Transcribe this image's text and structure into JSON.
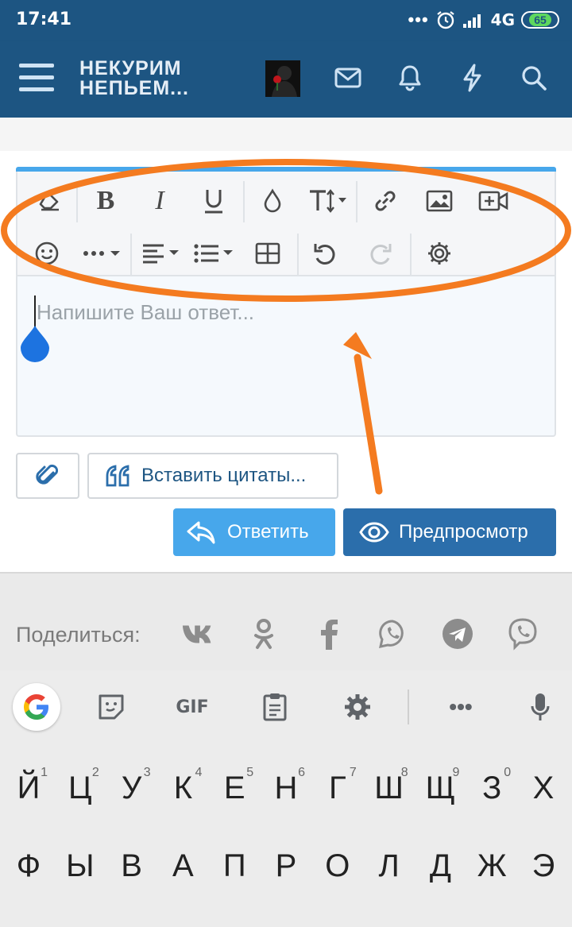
{
  "status": {
    "time": "17:41",
    "dots": "•••",
    "network": "4G",
    "battery": "65"
  },
  "header": {
    "logo_line1": "НЕКУРИМ",
    "logo_line2": "НЕПЬЕМ..."
  },
  "editor": {
    "placeholder": "Напишите Ваш ответ...",
    "toolbar_row1": [
      "eraser-icon",
      "bold-icon",
      "italic-icon",
      "underline-icon",
      "color-drop-icon",
      "font-size-icon",
      "link-icon",
      "image-icon",
      "video-icon"
    ],
    "toolbar_row2": [
      "smiley-icon",
      "more-icon",
      "align-icon",
      "list-icon",
      "table-icon",
      "undo-icon",
      "redo-icon",
      "settings-icon"
    ]
  },
  "buttons": {
    "quote_label": "Вставить цитаты...",
    "reply_label": "Ответить",
    "preview_label": "Предпросмотр"
  },
  "share": {
    "label": "Поделиться:",
    "icons": [
      "vk-icon",
      "ok-icon",
      "facebook-icon",
      "whatsapp-icon",
      "telegram-icon",
      "viber-icon"
    ]
  },
  "keyboard": {
    "toolbar_icons": [
      "google-icon",
      "sticker-icon",
      "gif-icon",
      "clipboard-icon",
      "settings-icon",
      "more-icon",
      "mic-icon"
    ],
    "gif_label": "GIF",
    "row1": [
      {
        "k": "Й",
        "n": "1"
      },
      {
        "k": "Ц",
        "n": "2"
      },
      {
        "k": "У",
        "n": "3"
      },
      {
        "k": "К",
        "n": "4"
      },
      {
        "k": "Е",
        "n": "5"
      },
      {
        "k": "Н",
        "n": "6"
      },
      {
        "k": "Г",
        "n": "7"
      },
      {
        "k": "Ш",
        "n": "8"
      },
      {
        "k": "Щ",
        "n": "9"
      },
      {
        "k": "З",
        "n": "0"
      },
      {
        "k": "Х",
        "n": ""
      }
    ],
    "row2": [
      "Ф",
      "Ы",
      "В",
      "А",
      "П",
      "Р",
      "О",
      "Л",
      "Д",
      "Ж",
      "Э"
    ]
  },
  "colors": {
    "header_bg": "#1d5582",
    "accent": "#47a7eb",
    "preview_bg": "#2b6eab",
    "annotation": "#f47b20"
  }
}
